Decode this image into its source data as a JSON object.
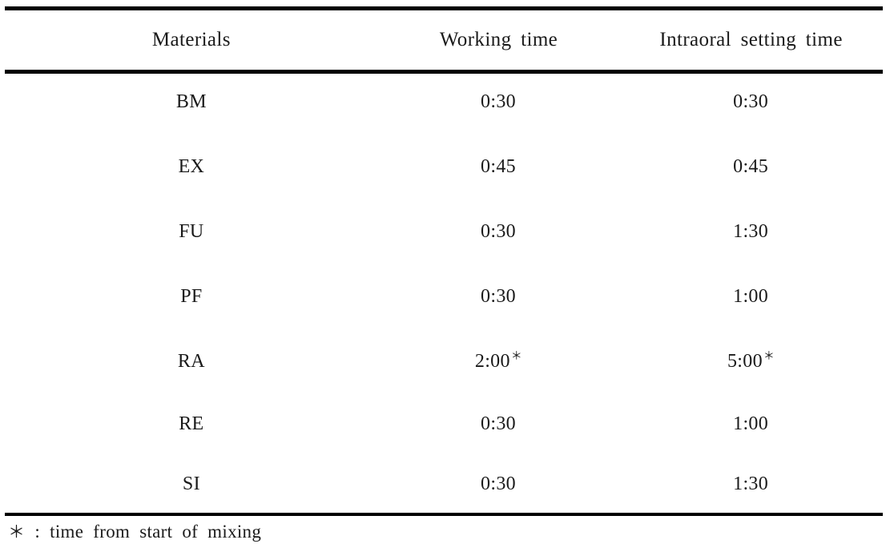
{
  "table": {
    "columns": [
      {
        "id": "materials",
        "label": "Materials"
      },
      {
        "id": "working_time",
        "label": "Working  time"
      },
      {
        "id": "intraoral_setting_time",
        "label": "Intraoral  setting  time"
      }
    ],
    "rows": [
      {
        "material": "BM",
        "working_time": "0:30",
        "working_mark": "",
        "intraoral_setting_time": "0:30",
        "intraoral_mark": ""
      },
      {
        "material": "EX",
        "working_time": "0:45",
        "working_mark": "",
        "intraoral_setting_time": "0:45",
        "intraoral_mark": ""
      },
      {
        "material": "FU",
        "working_time": "0:30",
        "working_mark": "",
        "intraoral_setting_time": "1:30",
        "intraoral_mark": ""
      },
      {
        "material": "PF",
        "working_time": "0:30",
        "working_mark": "",
        "intraoral_setting_time": "1:00",
        "intraoral_mark": ""
      },
      {
        "material": "RA",
        "working_time": "2:00",
        "working_mark": "＊",
        "intraoral_setting_time": "5:00",
        "intraoral_mark": "＊"
      },
      {
        "material": "RE",
        "working_time": "0:30",
        "working_mark": "",
        "intraoral_setting_time": "1:00",
        "intraoral_mark": ""
      },
      {
        "material": "SI",
        "working_time": "0:30",
        "working_mark": "",
        "intraoral_setting_time": "1:30",
        "intraoral_mark": ""
      }
    ]
  },
  "footnote": {
    "symbol": "＊",
    "separator": ":",
    "text": "time  from  start  of  mixing"
  },
  "style": {
    "rule_color": "#000000",
    "text_color": "#1a1a1a",
    "background": "#ffffff"
  }
}
